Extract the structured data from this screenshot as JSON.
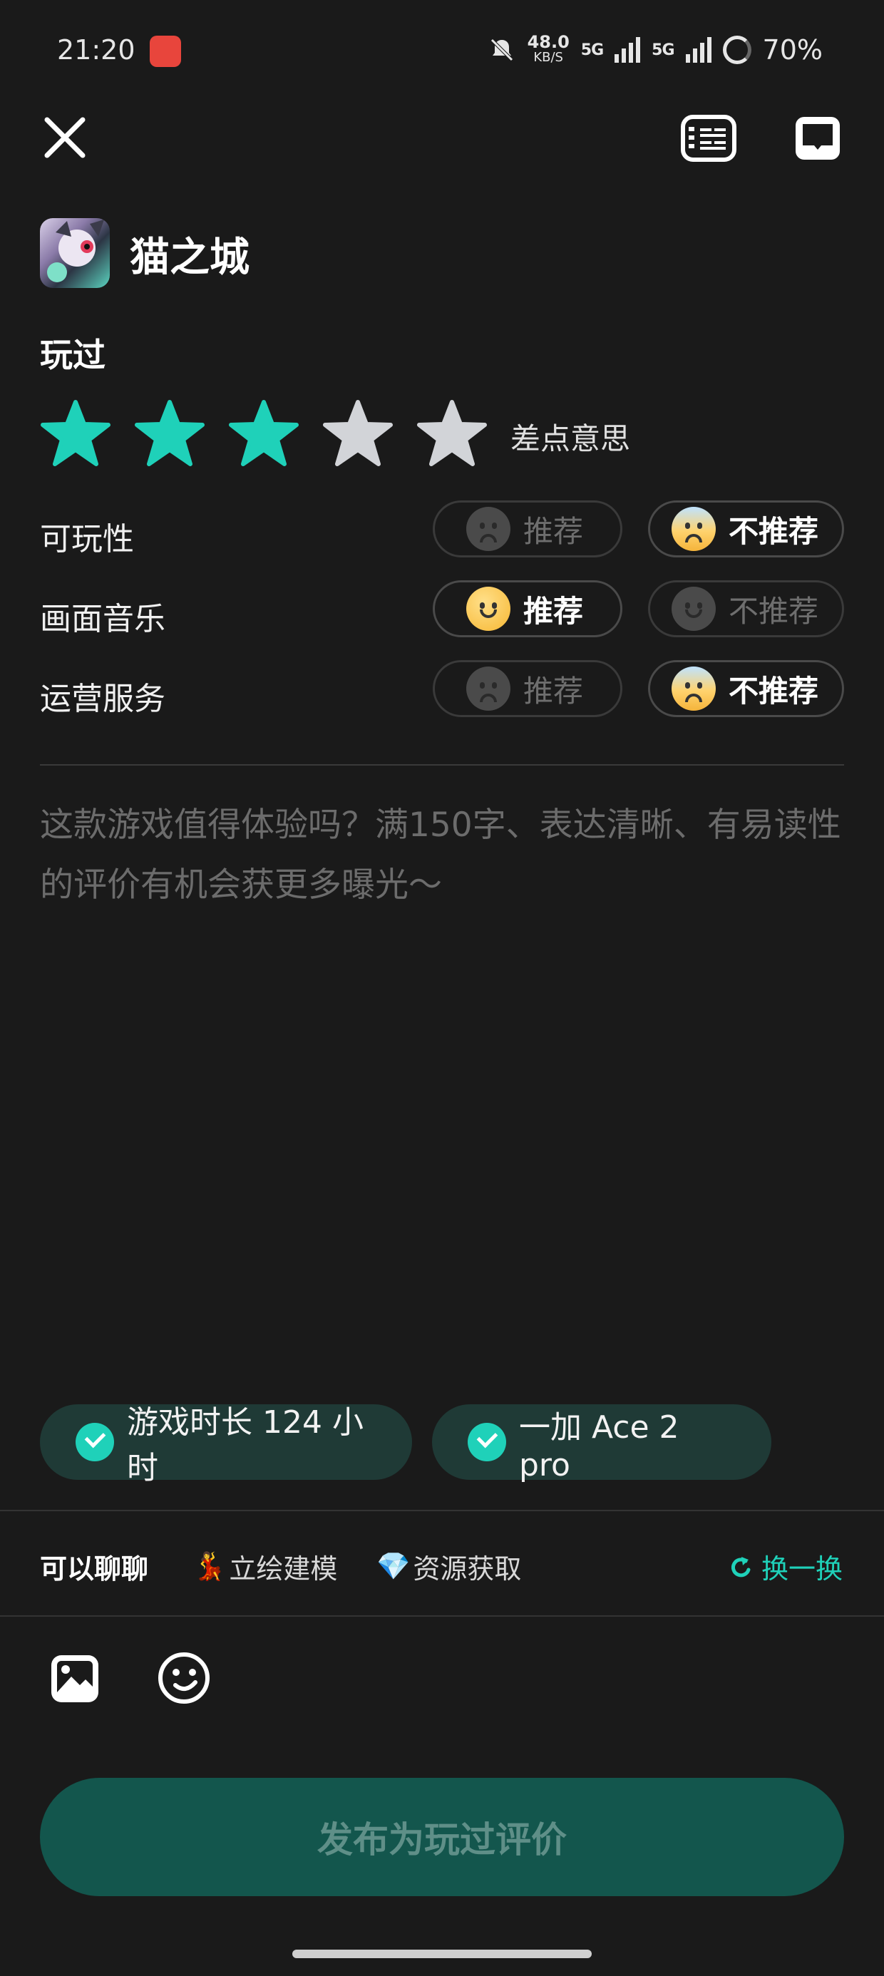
{
  "status_bar": {
    "time": "21:20",
    "speed_value": "48.0",
    "speed_unit": "KB/S",
    "sig1": "5G",
    "sig2": "5G",
    "battery": "70%"
  },
  "header": {
    "rules_icon": "review-rules-icon",
    "chat_icon": "chat-icon"
  },
  "game": {
    "title": "猫之城"
  },
  "review": {
    "status_label": "玩过",
    "rating": 3,
    "max_rating": 5,
    "rating_text": "差点意思",
    "colors": {
      "star_on": "#1fd1b9",
      "star_off": "#d2d4d8",
      "accent": "#1fd1b9"
    },
    "aspects": [
      {
        "label": "可玩性",
        "recommend": "推荐",
        "not_recommend": "不推荐",
        "selected": "not_recommend"
      },
      {
        "label": "画面音乐",
        "recommend": "推荐",
        "not_recommend": "不推荐",
        "selected": "recommend"
      },
      {
        "label": "运营服务",
        "recommend": "推荐",
        "not_recommend": "不推荐",
        "selected": "not_recommend"
      }
    ],
    "placeholder": "这款游戏值得体验吗？满150字、表达清晰、有易读性的评价有机会获更多曝光～"
  },
  "tags": [
    {
      "label": "游戏时长 124 小时",
      "checked": true
    },
    {
      "label": "一加 Ace 2 pro",
      "checked": true
    }
  ],
  "topics": {
    "label": "可以聊聊",
    "items": [
      {
        "emoji": "💃",
        "text": "立绘建模"
      },
      {
        "emoji": "💎",
        "text": "资源获取"
      }
    ],
    "refresh": "换一换"
  },
  "toolbar": {
    "image_icon": "image-icon",
    "emoji_icon": "emoji-icon"
  },
  "publish_button": "发布为玩过评价"
}
